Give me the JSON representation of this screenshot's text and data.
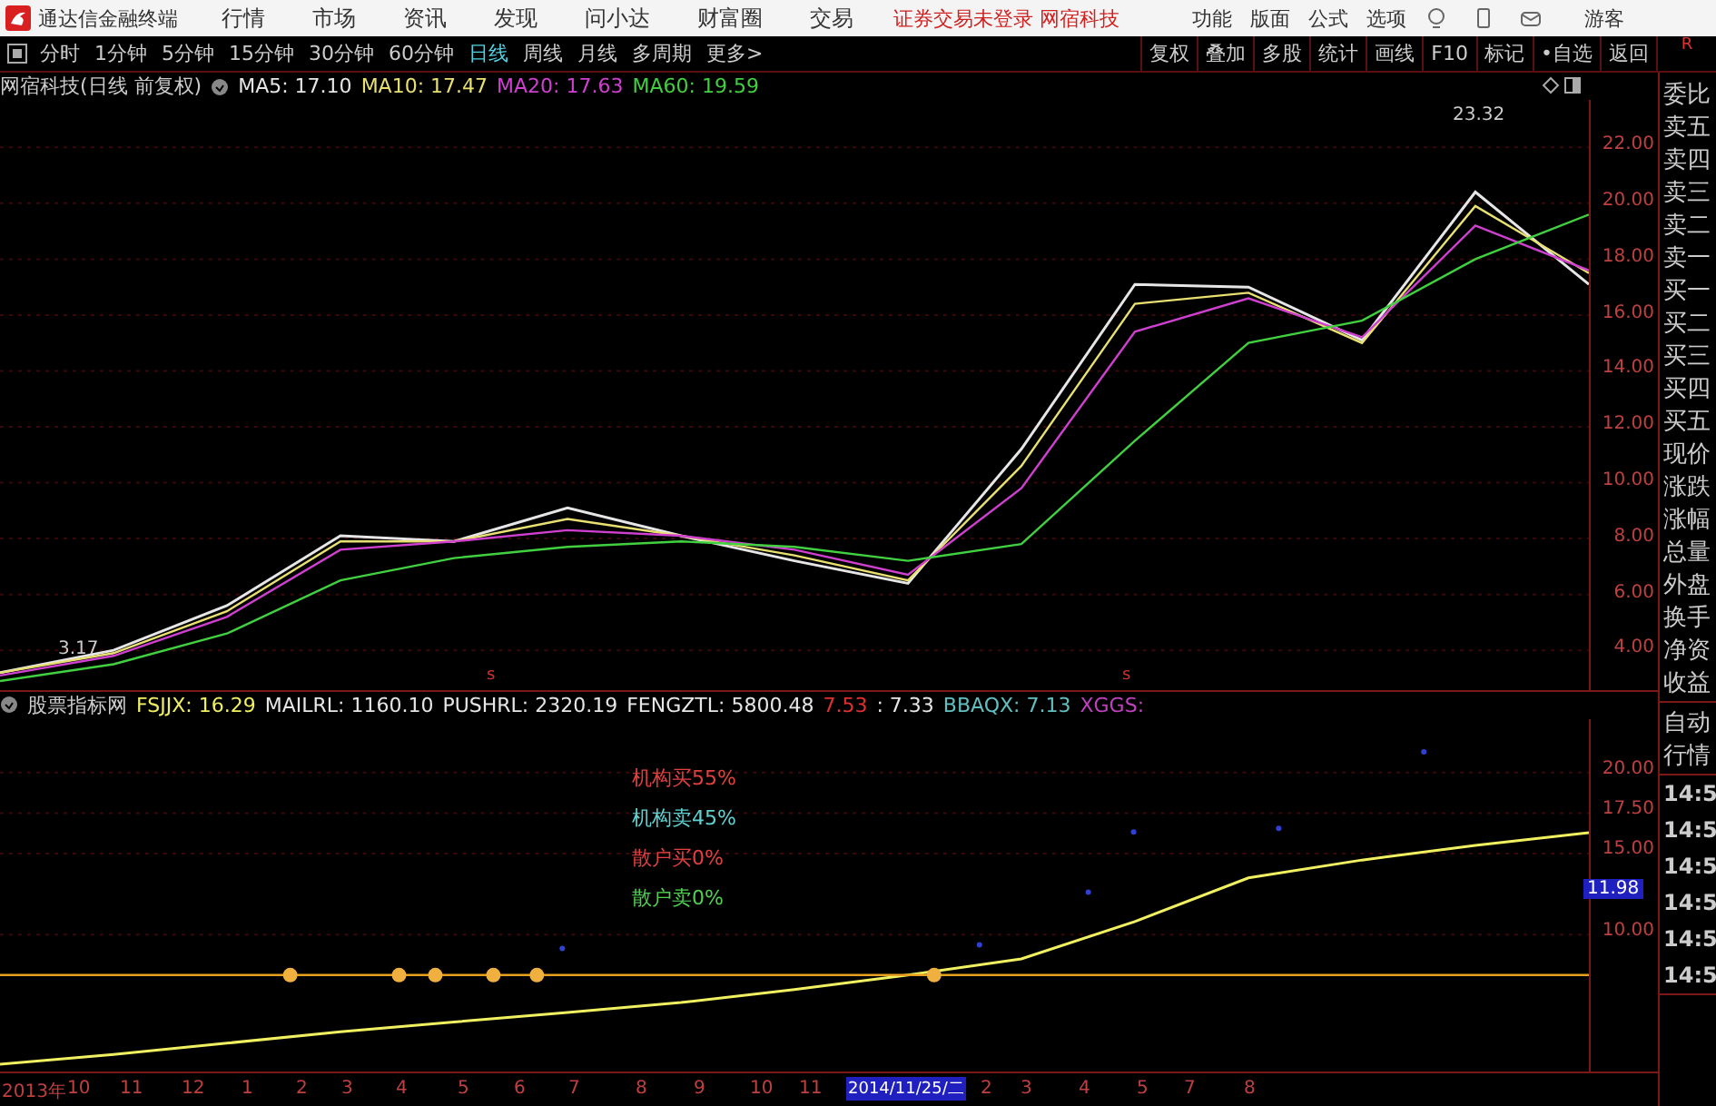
{
  "title_bar": {
    "app_title": "通达信金融终端",
    "menus": [
      "行情",
      "市场",
      "资讯",
      "发现",
      "问小达",
      "财富圈",
      "交易"
    ],
    "notice": "证券交易未登录 网宿科技",
    "tools": [
      "功能",
      "版面",
      "公式",
      "选项"
    ],
    "user": "游客"
  },
  "toolbar": {
    "periods": [
      {
        "label": "分时",
        "selected": false
      },
      {
        "label": "1分钟",
        "selected": false
      },
      {
        "label": "5分钟",
        "selected": false
      },
      {
        "label": "15分钟",
        "selected": false
      },
      {
        "label": "30分钟",
        "selected": false
      },
      {
        "label": "60分钟",
        "selected": false
      },
      {
        "label": "日线",
        "selected": true
      },
      {
        "label": "周线",
        "selected": false
      },
      {
        "label": "月线",
        "selected": false
      },
      {
        "label": "多周期",
        "selected": false
      },
      {
        "label": "更多>",
        "selected": false
      }
    ],
    "actions": [
      "复权",
      "叠加",
      "多股",
      "统计",
      "画线",
      "F10",
      "标记",
      "•自选",
      "返回"
    ]
  },
  "price_panel": {
    "title": "网宿科技(日线 前复权)",
    "readings": [
      ": 17.10",
      ": 17.47",
      ": 17.63",
      ": 19.59"
    ],
    "high_label": "23.32",
    "low_label": "3.17",
    "marks": [
      "s",
      "s"
    ],
    "chart_data": {
      "type": "line",
      "grid": true,
      "ylim": [
        2.6,
        23.7
      ],
      "yticks": [
        {
          "value": 22,
          "label": "22.00"
        },
        {
          "value": 20,
          "label": "20.00"
        },
        {
          "value": 18,
          "label": "18.00"
        },
        {
          "value": 16,
          "label": "16.00"
        },
        {
          "value": 14,
          "label": "14.00"
        },
        {
          "value": 12,
          "label": "12.00"
        },
        {
          "value": 10,
          "label": "10.00"
        },
        {
          "value": 8,
          "label": "8.00"
        },
        {
          "value": 6,
          "label": "6.00"
        },
        {
          "value": 4,
          "label": "4.00"
        }
      ],
      "series": [
        {
          "name": "MA5",
          "color": "#e6e6e6",
          "values": [
            3.2,
            4.0,
            5.6,
            8.1,
            7.9,
            9.1,
            8.1,
            7.2,
            6.4,
            11.2,
            17.1,
            17.0,
            15.1,
            20.4,
            17.1
          ]
        },
        {
          "name": "MA10",
          "color": "#e8e070",
          "values": [
            3.2,
            3.9,
            5.4,
            7.9,
            7.9,
            8.7,
            8.1,
            7.4,
            6.5,
            10.6,
            16.4,
            16.8,
            15.0,
            19.9,
            17.5
          ]
        },
        {
          "name": "MA20",
          "color": "#d040d0",
          "values": [
            3.1,
            3.8,
            5.2,
            7.6,
            7.9,
            8.3,
            8.1,
            7.6,
            6.7,
            9.8,
            15.4,
            16.6,
            15.2,
            19.2,
            17.6
          ]
        },
        {
          "name": "MA60",
          "color": "#40d040",
          "values": [
            2.9,
            3.5,
            4.6,
            6.5,
            7.3,
            7.7,
            7.9,
            7.7,
            7.2,
            7.8,
            11.5,
            15.0,
            15.8,
            18.0,
            19.6
          ]
        }
      ]
    }
  },
  "indicator_panel": {
    "title": "股票指标网",
    "values": [
      {
        "text": "MAILRL: 1160.10",
        "color": "#e6e6e6"
      },
      {
        "text": "PUSHRL: 2320.19",
        "color": "#e6e6e6"
      },
      {
        "text": "FENGZTL: 5800.48",
        "color": "#e6e6e6"
      },
      {
        "text": "7.53",
        "color": "#e03030"
      },
      {
        "text": ": 7.33",
        "color": "#e6e6e6"
      },
      {
        "text": "BBAQX: 7.13",
        "color": "#60c0c0"
      },
      {
        "text": "XGGS:",
        "color": "#c040c0"
      }
    ],
    "signals": [
      {
        "text": "机构买55%",
        "color": "#e04040"
      },
      {
        "text": "机构卖45%",
        "color": "#60d0d0"
      },
      {
        "text": "散户买0%",
        "color": "#e04040"
      },
      {
        "text": "散户卖0%",
        "color": "#50d050"
      }
    ],
    "current_value": "11.98",
    "readings": [
      ": 16.29"
    ],
    "chart_data": {
      "type": "line",
      "grid": true,
      "ylim": [
        1.5,
        23.3
      ],
      "yticks": [
        {
          "value": 20,
          "label": "20.00"
        },
        {
          "value": 17.5,
          "label": "17.50"
        },
        {
          "value": 15,
          "label": "15.00"
        },
        {
          "value": 10,
          "label": "10.00"
        }
      ],
      "series": [
        {
          "name": "FSJJX",
          "color": "#f0f060",
          "values": [
            2.0,
            2.6,
            3.3,
            4.0,
            4.6,
            5.2,
            5.8,
            6.6,
            7.5,
            8.5,
            10.8,
            13.5,
            14.6,
            15.5,
            16.3
          ]
        },
        {
          "color": "#e8a020",
          "values": [
            7.5,
            7.5,
            7.5,
            7.5,
            7.5,
            7.5,
            7.5,
            7.5,
            7.5,
            7.5,
            7.5,
            7.5,
            7.5,
            7.5,
            7.5
          ]
        }
      ]
    }
  },
  "date_axis": [
    {
      "label": "2013年",
      "selected": false
    },
    {
      "label": "10",
      "selected": false
    },
    {
      "label": "11",
      "selected": false
    },
    {
      "label": "12",
      "selected": false
    },
    {
      "label": "1",
      "selected": false
    },
    {
      "label": "2",
      "selected": false
    },
    {
      "label": "3",
      "selected": false
    },
    {
      "label": "4",
      "selected": false
    },
    {
      "label": "5",
      "selected": false
    },
    {
      "label": "6",
      "selected": false
    },
    {
      "label": "7",
      "selected": false
    },
    {
      "label": "8",
      "selected": false
    },
    {
      "label": "9",
      "selected": false
    },
    {
      "label": "10",
      "selected": false
    },
    {
      "label": "11",
      "selected": false
    },
    {
      "label": "2014/11/25/二",
      "selected": true
    },
    {
      "label": "2",
      "selected": false
    },
    {
      "label": "3",
      "selected": false
    },
    {
      "label": "4",
      "selected": false
    },
    {
      "label": "5",
      "selected": false
    },
    {
      "label": "7",
      "selected": false
    },
    {
      "label": "8",
      "selected": false
    }
  ],
  "side_panel": {
    "corner": "R",
    "quote_labels": [
      "委比",
      "卖五",
      "卖四",
      "卖三",
      "卖二",
      "卖一",
      "买一",
      "买二",
      "买三",
      "买四",
      "买五",
      "现价",
      "涨跌",
      "涨幅",
      "总量",
      "外盘",
      "换手",
      "净资",
      "收益"
    ],
    "lower_labels": [
      "自动",
      "行情"
    ],
    "times": [
      "14:5",
      "14:5",
      "14:5",
      "14:5",
      "14:5",
      "14:5"
    ]
  }
}
